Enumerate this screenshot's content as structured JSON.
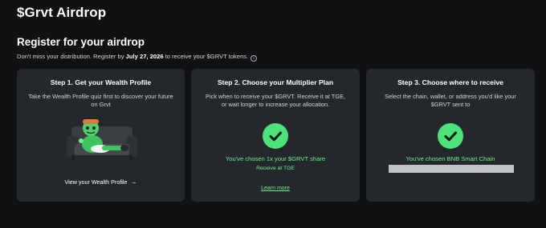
{
  "page": {
    "title": "$Grvt Airdrop"
  },
  "section": {
    "title": "Register for your airdrop",
    "subtitle_before": "Don't miss your distribution. Register by ",
    "subtitle_date": "July 27, 2026",
    "subtitle_after": " to receive your $GRVT tokens.",
    "info_icon": "i"
  },
  "steps": [
    {
      "title": "Step 1. Get your Wealth Profile",
      "description": "Take the Wealth Profile quiz first to discover your future on Grvt",
      "illustration": "character-on-couch",
      "link_label": "View your Wealth Profile",
      "link_icon": "arrow-right-icon"
    },
    {
      "title": "Step 2. Choose your Multiplier Plan",
      "description": "Pick when to receive your $GRVT. Receive it at TGE, or wait longer to increase your allocation.",
      "status_icon": "check-icon",
      "chosen_text": "You've chosen 1x your $GRVT share",
      "receive_text": "Receive at TGE",
      "link_label": "Learn more"
    },
    {
      "title": "Step 3. Choose where to receive",
      "description": "Select the chain, wallet, or address you'd like your $GRVT sent to",
      "status_icon": "check-icon",
      "chosen_text": "You've chosen BNB Smart Chain"
    }
  ],
  "colors": {
    "background": "#101113",
    "card": "#24272b",
    "accent_green": "#4ee27a",
    "green_text": "#6ff08f",
    "redaction": "#c0c2c5"
  }
}
